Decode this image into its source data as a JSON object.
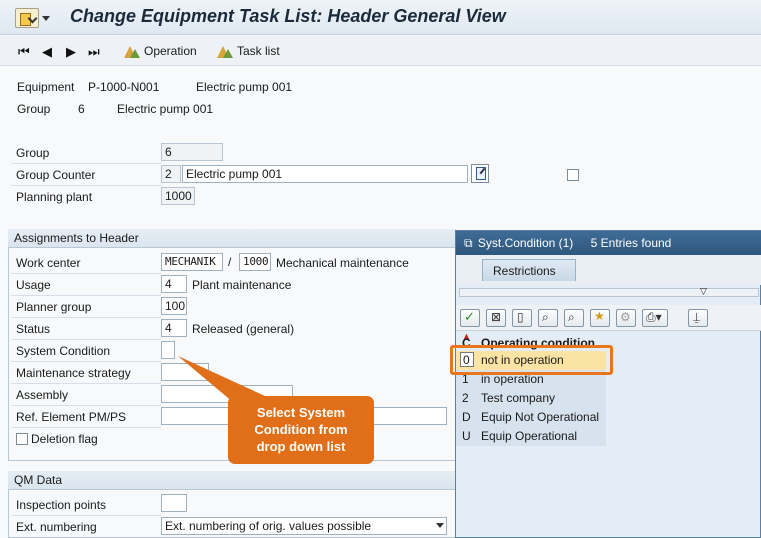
{
  "window": {
    "title": "Change Equipment Task List: Header General View"
  },
  "toolbar": {
    "nav_icons": [
      "first-page-icon",
      "previous-page-icon",
      "next-page-icon",
      "last-page-icon"
    ],
    "operation_label": "Operation",
    "task_list_label": "Task list"
  },
  "header_info": {
    "equipment_label": "Equipment",
    "equipment_value": "P-1000-N001",
    "equipment_desc": "Electric pump 001",
    "group_label": "Group",
    "group_value": "6",
    "group_desc": "Electric pump 001"
  },
  "general": {
    "group_label": "Group",
    "group_value": "6",
    "group_counter_label": "Group Counter",
    "group_counter_value": "2",
    "group_counter_desc": "Electric pump 001",
    "planning_plant_label": "Planning plant",
    "planning_plant_value": "1000"
  },
  "assignments": {
    "title": "Assignments to Header",
    "work_center_label": "Work center",
    "work_center_value": "MECHANIK",
    "work_center_sep": "/",
    "work_center_plant": "1000",
    "work_center_desc": "Mechanical maintenance",
    "usage_label": "Usage",
    "usage_value": "4",
    "usage_desc": "Plant maintenance",
    "planner_group_label": "Planner group",
    "planner_group_value": "100",
    "status_label": "Status",
    "status_value": "4",
    "status_desc": "Released (general)",
    "system_condition_label": "System Condition",
    "system_condition_value": "",
    "maintenance_strategy_label": "Maintenance strategy",
    "assembly_label": "Assembly",
    "ref_element_label": "Ref. Element PM/PS",
    "deletion_flag_label": "Deletion flag"
  },
  "qm": {
    "title": "QM Data",
    "inspection_points_label": "Inspection points",
    "ext_numbering_label": "Ext. numbering",
    "ext_numbering_value": "Ext. numbering of orig. values possible"
  },
  "popup": {
    "title": "Syst.Condition (1)",
    "entries_found": "5 Entries found",
    "tab_restrictions": "Restrictions",
    "col_key": "C",
    "col_desc": "Operating condition",
    "rows": [
      {
        "key": "0",
        "desc": "not in operation"
      },
      {
        "key": "1",
        "desc": "in operation"
      },
      {
        "key": "2",
        "desc": "Test company"
      },
      {
        "key": "D",
        "desc": "Equip Not Operational"
      },
      {
        "key": "U",
        "desc": "Equip Operational"
      }
    ]
  },
  "callout": {
    "line1": "Select System",
    "line2": "Condition from",
    "line3": "drop down list"
  },
  "colors": {
    "accent": "#e16f19",
    "popup_title_bg": "#3f6c96",
    "selected_row": "#fbe3a3"
  }
}
